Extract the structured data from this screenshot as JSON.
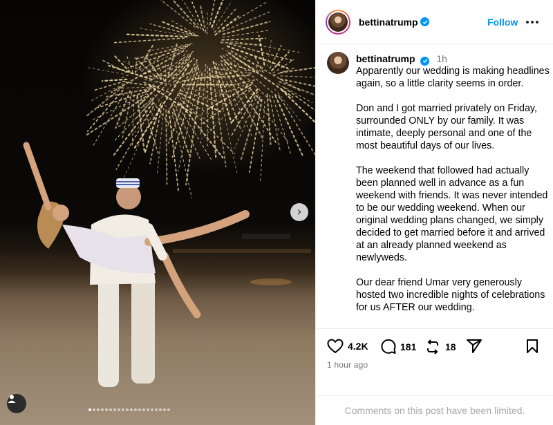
{
  "post": {
    "username": "bettinatrump",
    "follow_label": "Follow",
    "time_ago_short": "1h",
    "time_ago_long": "1 hour ago",
    "caption_paragraphs": [
      "Apparently our wedding is making headlines again, so a little clarity seems in order.",
      "Don and I got married privately on Friday, surrounded ONLY by our family. It was intimate, deeply personal and one of the most beautiful days of our lives.",
      "The weekend that followed had actually been planned well in advance as a fun weekend with friends. It was never intended to be our wedding weekend. When our original wedding plans changed, we simply decided to get married before it and arrived at an already planned weekend as newlyweds.",
      "Our dear friend Umar very generously hosted two incredible nights of celebrations for us AFTER our wedding."
    ],
    "likes": "4.2K",
    "comments": "181",
    "reposts": "18",
    "comments_limited": "Comments on this post have been limited."
  },
  "carousel": {
    "total": 20,
    "active_index": 0
  },
  "icons": {
    "verified": "verified-badge-icon",
    "more": "more-options-icon",
    "next": "chevron-right-icon",
    "tag": "user-tag-icon",
    "like": "heart-icon",
    "comment": "comment-icon",
    "repost": "repost-icon",
    "share": "send-icon",
    "save": "bookmark-icon"
  },
  "colors": {
    "accent": "#0095f6",
    "secondary_text": "#737373",
    "muted_text": "#a8a8a8"
  }
}
